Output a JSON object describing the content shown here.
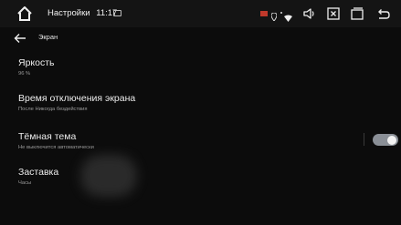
{
  "status_bar": {
    "title": "Настройки",
    "time": "11:17",
    "icons": [
      "home-icon",
      "message-icon",
      "flag-icon",
      "location-icon",
      "wifi-icon",
      "volume-icon",
      "close-box-icon",
      "recent-apps-icon",
      "back-icon"
    ]
  },
  "header": {
    "back_icon": "arrow-left-icon",
    "title": "Экран"
  },
  "settings": [
    {
      "title": "Яркость",
      "subtitle": "96 %"
    },
    {
      "title": "Время отключения экрана",
      "subtitle": "После Никогда бездействия"
    },
    {
      "title": "Тёмная тема",
      "subtitle": "Не выключится автоматически",
      "toggle": true
    },
    {
      "title": "Заставка",
      "subtitle": "Часы"
    }
  ],
  "colors": {
    "background": "#0c0c0c",
    "status_bar": "#141414",
    "toggle_track": "#8a8f96",
    "toggle_knob": "#f2f2f2",
    "flag": "#c0392b"
  }
}
